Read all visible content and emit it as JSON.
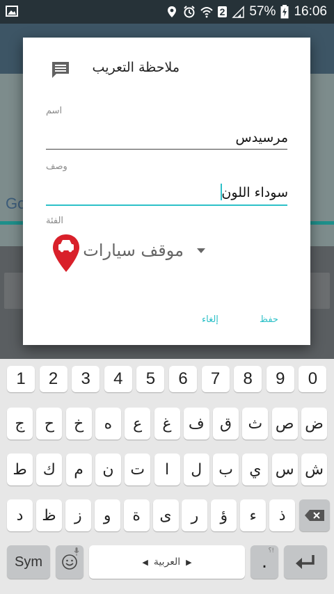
{
  "status_bar": {
    "battery": "57%",
    "time": "16:06",
    "sim": "2"
  },
  "dialog": {
    "title": "ملاحظة التعريب",
    "name_label": "اسم",
    "name_value": "مرسيدس",
    "desc_label": "وصف",
    "desc_value": "سوداء اللون",
    "category_label": "الفئة",
    "category_value": "موقف سيارات",
    "save_label": "حفظ",
    "cancel_label": "إلغاء"
  },
  "background": {
    "map_logo": "Go"
  },
  "keyboard": {
    "numbers": [
      "1",
      "2",
      "3",
      "4",
      "5",
      "6",
      "7",
      "8",
      "9",
      "0"
    ],
    "row1": [
      "ض",
      "ص",
      "ث",
      "ق",
      "ف",
      "غ",
      "ع",
      "ه",
      "خ",
      "ح",
      "ج"
    ],
    "row2": [
      "ش",
      "س",
      "ي",
      "ب",
      "ل",
      "ا",
      "ت",
      "ن",
      "م",
      "ك",
      "ط"
    ],
    "row3": [
      "ذ",
      "ء",
      "ؤ",
      "ر",
      "ى",
      "ة",
      "و",
      "ز",
      "ظ",
      "د"
    ],
    "sym_label": "Sym",
    "space_label": "العربية",
    "period_label": ".",
    "period_hint": "؟!"
  },
  "colors": {
    "accent": "#2cc0c8",
    "status_bar": "#263238",
    "pin": "#d9202a"
  }
}
